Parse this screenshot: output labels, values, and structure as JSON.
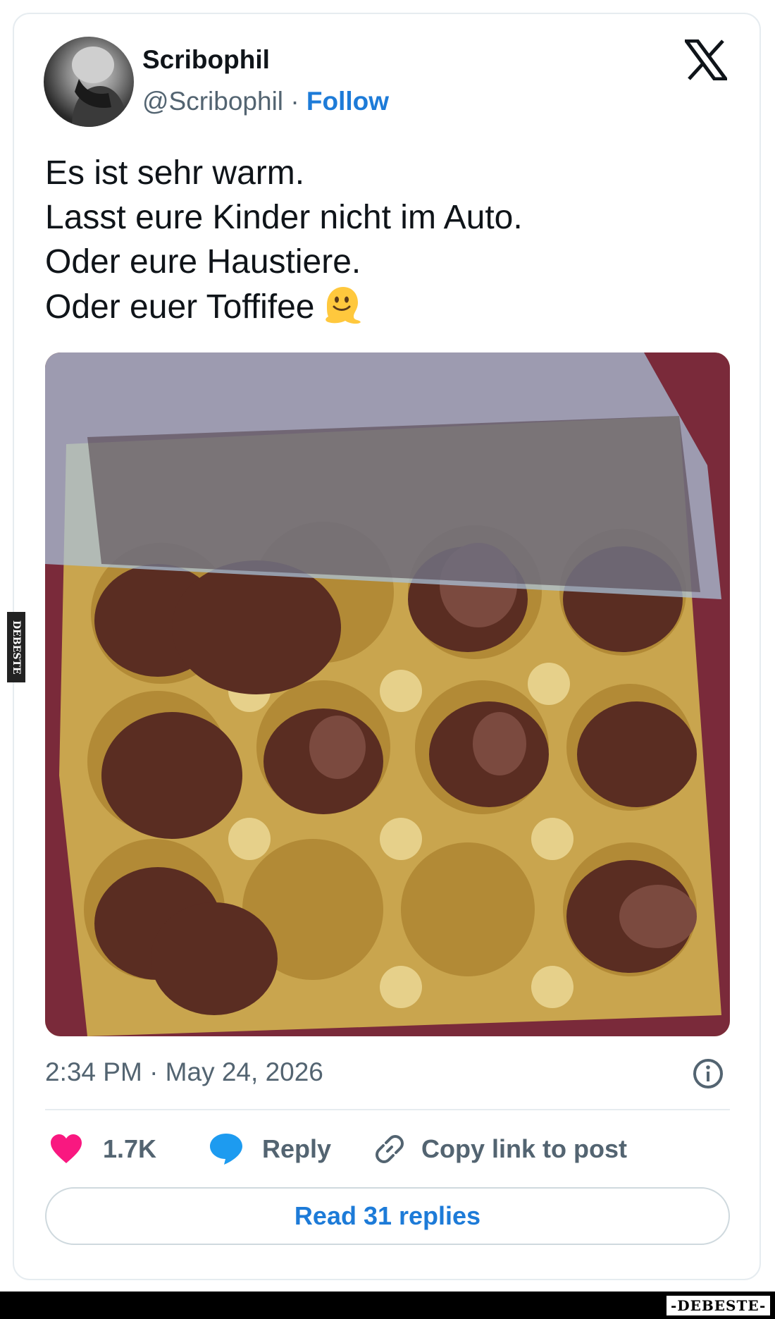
{
  "author": {
    "name": "Scribophil",
    "handle": "@Scribophil",
    "separator": "·",
    "follow_label": "Follow"
  },
  "platform_icon": "x-logo-icon",
  "tweet": {
    "lines": [
      "Es ist sehr warm.",
      "Lasst eure Kinder nicht im Auto.",
      "Oder eure Haustiere.",
      "Oder euer Toffifee"
    ],
    "emoji": "melting-face-emoji"
  },
  "photo": {
    "subject": "melted-toffifee-tray"
  },
  "meta": {
    "timestamp": "2:34 PM · May 24, 2026",
    "info_icon": "info-icon"
  },
  "actions": {
    "likes_count": "1.7K",
    "reply_label": "Reply",
    "copy_label": "Copy link to post"
  },
  "read_replies_label": "Read 31 replies",
  "watermarks": {
    "side": "DEBESTE",
    "stamp": "-DEBESTE-"
  },
  "colors": {
    "accent_blue": "#1d7bd8",
    "like_pink": "#f91880",
    "reply_blue": "#1d9bf0",
    "muted_text": "#536471",
    "border": "#e6ecf0"
  }
}
